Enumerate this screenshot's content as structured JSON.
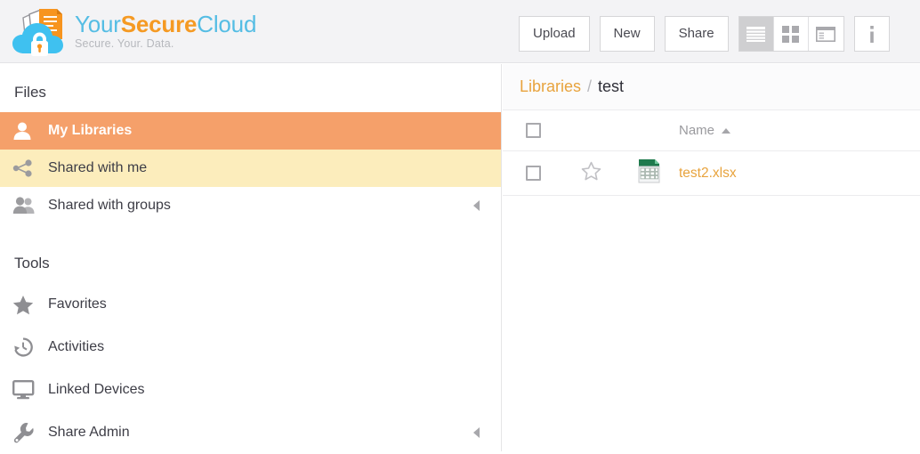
{
  "brand": {
    "logo_icon": "cloud-lock-documents-logo",
    "name_part1": "Your",
    "name_part2": "Secure",
    "name_part3": "Cloud",
    "tagline": "Secure. Your. Data.",
    "color_blue": "#55bde4",
    "color_orange": "#f59a23",
    "color_tagline": "#b6b8bd"
  },
  "toolbar": {
    "upload_label": "Upload",
    "new_label": "New",
    "share_label": "Share",
    "view_list_icon": "list-view-icon",
    "view_grid_icon": "grid-view-icon",
    "view_detail_icon": "detail-view-icon",
    "info_icon": "info-icon",
    "active_view": "list",
    "active_bg": "#cfcfd1"
  },
  "sidebar": {
    "files_heading": "Files",
    "tools_heading": "Tools",
    "accent_selected": "#f5a06a",
    "accent_highlight": "#fcedbc",
    "files_items": [
      {
        "label": "My Libraries",
        "icon": "user-icon",
        "state": "selected",
        "arrow": false
      },
      {
        "label": "Shared with me",
        "icon": "share-nodes-icon",
        "state": "highlight",
        "arrow": false
      },
      {
        "label": "Shared with groups",
        "icon": "users-group-icon",
        "state": "normal",
        "arrow": true
      }
    ],
    "tools_items": [
      {
        "label": "Favorites",
        "icon": "star-icon",
        "arrow": false
      },
      {
        "label": "Activities",
        "icon": "clock-history-icon",
        "arrow": false
      },
      {
        "label": "Linked Devices",
        "icon": "monitor-icon",
        "arrow": false
      },
      {
        "label": "Share Admin",
        "icon": "wrench-icon",
        "arrow": true
      }
    ]
  },
  "main": {
    "breadcrumb": {
      "root_label": "Libraries",
      "separator": "/",
      "current_label": "test"
    },
    "table": {
      "select_all_icon": "checkbox-unchecked-icon",
      "name_header": "Name",
      "sort_direction_icon": "sort-ascending-caret-icon",
      "rows": [
        {
          "checkbox_icon": "checkbox-unchecked-icon",
          "star_icon": "star-outline-icon",
          "file_icon": "xlsx-spreadsheet-icon",
          "name": "test2.xlsx",
          "name_color": "#e8a33d"
        }
      ]
    }
  }
}
